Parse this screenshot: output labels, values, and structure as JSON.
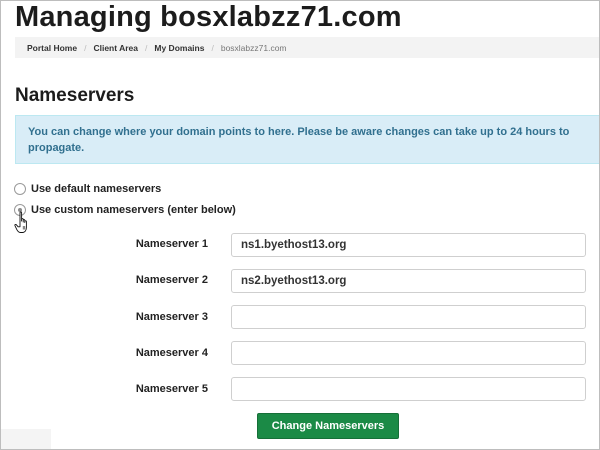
{
  "page": {
    "title": "Managing bosxlabzz71.com"
  },
  "breadcrumb": [
    {
      "label": "Portal Home"
    },
    {
      "label": "Client Area"
    },
    {
      "label": "My Domains"
    },
    {
      "label": "bosxlabzz71.com",
      "current": true
    }
  ],
  "section": {
    "title": "Nameservers",
    "info": "You can change where your domain points to here. Please be aware changes can take up to 24 hours to propagate."
  },
  "options": {
    "default_label": "Use default nameservers",
    "custom_label": "Use custom nameservers (enter below)",
    "selected": "custom"
  },
  "nameservers": [
    {
      "label": "Nameserver 1",
      "value": "ns1.byethost13.org"
    },
    {
      "label": "Nameserver 2",
      "value": "ns2.byethost13.org"
    },
    {
      "label": "Nameserver 3",
      "value": ""
    },
    {
      "label": "Nameserver 4",
      "value": ""
    },
    {
      "label": "Nameserver 5",
      "value": ""
    }
  ],
  "submit": {
    "label": "Change Nameservers"
  },
  "colors": {
    "info_bg": "#d9edf7",
    "info_text": "#31708f",
    "button": "#1b8a46"
  }
}
